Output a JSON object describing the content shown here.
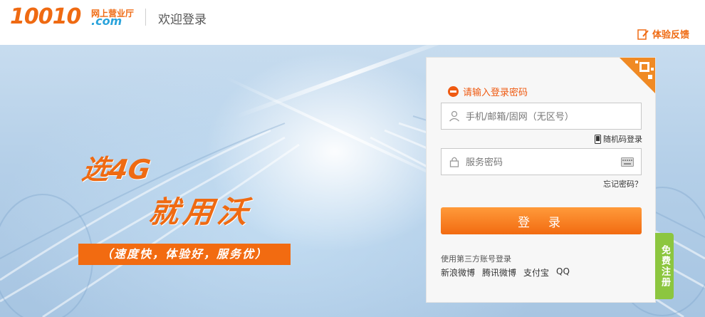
{
  "header": {
    "logo_number": "10010",
    "logo_cn": "网上营业厅",
    "logo_com": ".com",
    "page_title": "欢迎登录",
    "feedback_label": "体验反馈"
  },
  "banner": {
    "slogan_line1": "选4G",
    "slogan_line2": "就用沃",
    "slogan_bar": "（速度快，体验好，服务优）"
  },
  "login": {
    "error_message": "请输入登录密码",
    "account_placeholder": "手机/邮箱/固网（无区号）",
    "random_code_link": "随机码登录",
    "password_placeholder": "服务密码",
    "forgot_link": "忘记密码？",
    "submit_label": "登录",
    "third_party_label": "使用第三方账号登录",
    "third_party": [
      "新浪微博",
      "腾讯微博",
      "支付宝",
      "QQ"
    ]
  },
  "register_tab": "免费注册",
  "colors": {
    "brand_orange": "#ef6a12",
    "brand_blue": "#2aa3db",
    "register_green": "#8cc63f"
  }
}
